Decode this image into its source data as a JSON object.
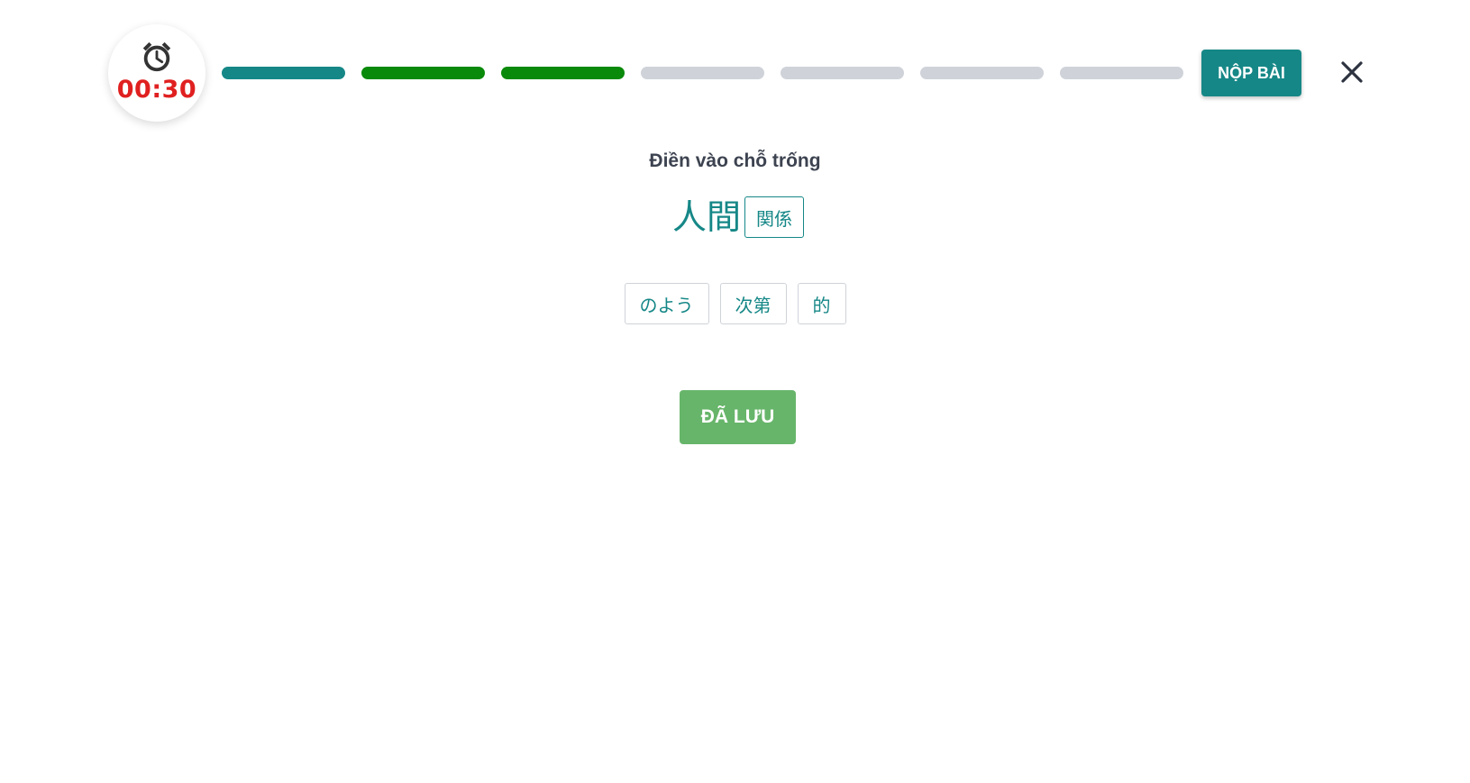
{
  "timer": {
    "time": "00:30",
    "icon": "alarm-clock-icon",
    "color": "#e02020"
  },
  "progress": {
    "segments": [
      "done",
      "current",
      "current",
      "pending",
      "pending",
      "pending",
      "pending"
    ],
    "colors": {
      "done": "#168787",
      "current": "#0a8a0a",
      "pending": "#cfd3d9"
    }
  },
  "header": {
    "submit_label": "NỘP BÀI",
    "close_icon": "close-icon"
  },
  "question": {
    "instruction": "Điền vào chỗ trống",
    "text": "人間",
    "filled_answer": "関係"
  },
  "options": [
    "のよう",
    "次第",
    "的"
  ],
  "actions": {
    "save_label": "ĐÃ LƯU"
  },
  "colors": {
    "accent": "#168787",
    "save_button": "#67b56a"
  }
}
